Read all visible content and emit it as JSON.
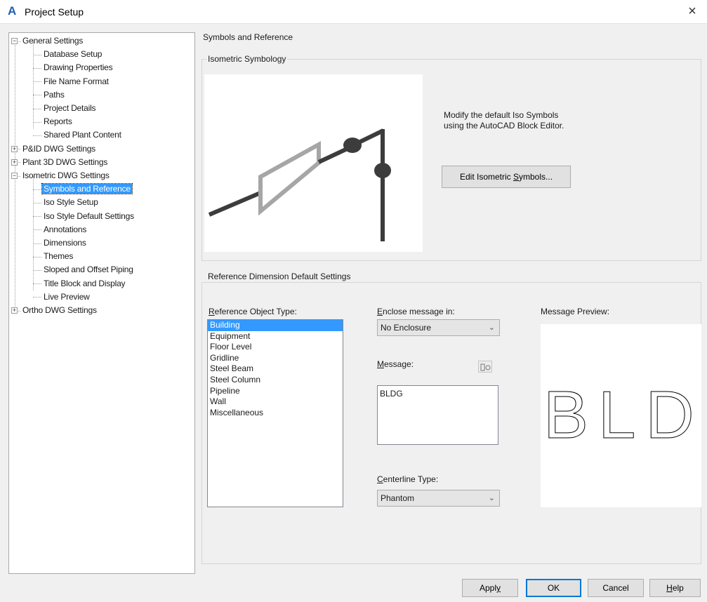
{
  "window": {
    "title": "Project Setup",
    "close": "×"
  },
  "tree": {
    "nodes": [
      {
        "label": "General Settings",
        "level": 0,
        "expander": "−"
      },
      {
        "label": "Database Setup",
        "level": 1
      },
      {
        "label": "Drawing Properties",
        "level": 1
      },
      {
        "label": "File Name Format",
        "level": 1
      },
      {
        "label": "Paths",
        "level": 1
      },
      {
        "label": "Project Details",
        "level": 1
      },
      {
        "label": "Reports",
        "level": 1
      },
      {
        "label": "Shared Plant Content",
        "level": 1
      },
      {
        "label": "P&ID DWG Settings",
        "level": 0,
        "expander": "+"
      },
      {
        "label": "Plant 3D DWG Settings",
        "level": 0,
        "expander": "+"
      },
      {
        "label": "Isometric DWG Settings",
        "level": 0,
        "expander": "−"
      },
      {
        "label": "Symbols and Reference",
        "level": 1,
        "selected": true
      },
      {
        "label": "Iso Style Setup",
        "level": 1
      },
      {
        "label": "Iso Style Default Settings",
        "level": 1
      },
      {
        "label": "Annotations",
        "level": 1
      },
      {
        "label": "Dimensions",
        "level": 1
      },
      {
        "label": "Themes",
        "level": 1
      },
      {
        "label": "Sloped and Offset Piping",
        "level": 1
      },
      {
        "label": "Title Block and Display",
        "level": 1
      },
      {
        "label": "Live Preview",
        "level": 1
      },
      {
        "label": "Ortho DWG Settings",
        "level": 0,
        "expander": "+"
      }
    ]
  },
  "content": {
    "section_title": "Symbols and Reference",
    "iso_group": {
      "label": "Isometric Symbology",
      "description_line1": "Modify the default Iso Symbols",
      "description_line2": "using the AutoCAD Block Editor.",
      "edit_button_pre": "Edit Isometric ",
      "edit_button_acc": "S",
      "edit_button_post": "ymbols..."
    },
    "ref_group": {
      "label": "Reference Dimension Default Settings",
      "ref_type_label_acc": "R",
      "ref_type_label_rest": "eference Object Type:",
      "ref_types": [
        "Building",
        "Equipment",
        "Floor Level",
        "Gridline",
        "Steel Beam",
        "Steel Column",
        "Pipeline",
        "Wall",
        "Miscellaneous"
      ],
      "ref_type_selected": "Building",
      "enclose_label_acc": "E",
      "enclose_label_rest": "nclose message in:",
      "enclose_value": "No Enclosure",
      "message_label_acc": "M",
      "message_label_rest": "essage:",
      "message_value": "BLDG",
      "centerline_label_acc": "C",
      "centerline_label_rest": "enterline Type:",
      "centerline_value": "Phantom",
      "preview_label": "Message Preview:",
      "preview_text": "BLDG"
    }
  },
  "footer": {
    "apply_pre": "Appl",
    "apply_acc": "y",
    "ok": "OK",
    "cancel": "Cancel",
    "help_acc": "H",
    "help_rest": "elp"
  },
  "colors": {
    "selection": "#3399ff",
    "symbol_dark": "#3c3c3c",
    "symbol_light": "#a6a6a6"
  },
  "icons": [
    "app-icon",
    "close-icon",
    "expand-icon",
    "collapse-icon",
    "chevron-down-icon",
    "insert-field-icon"
  ]
}
